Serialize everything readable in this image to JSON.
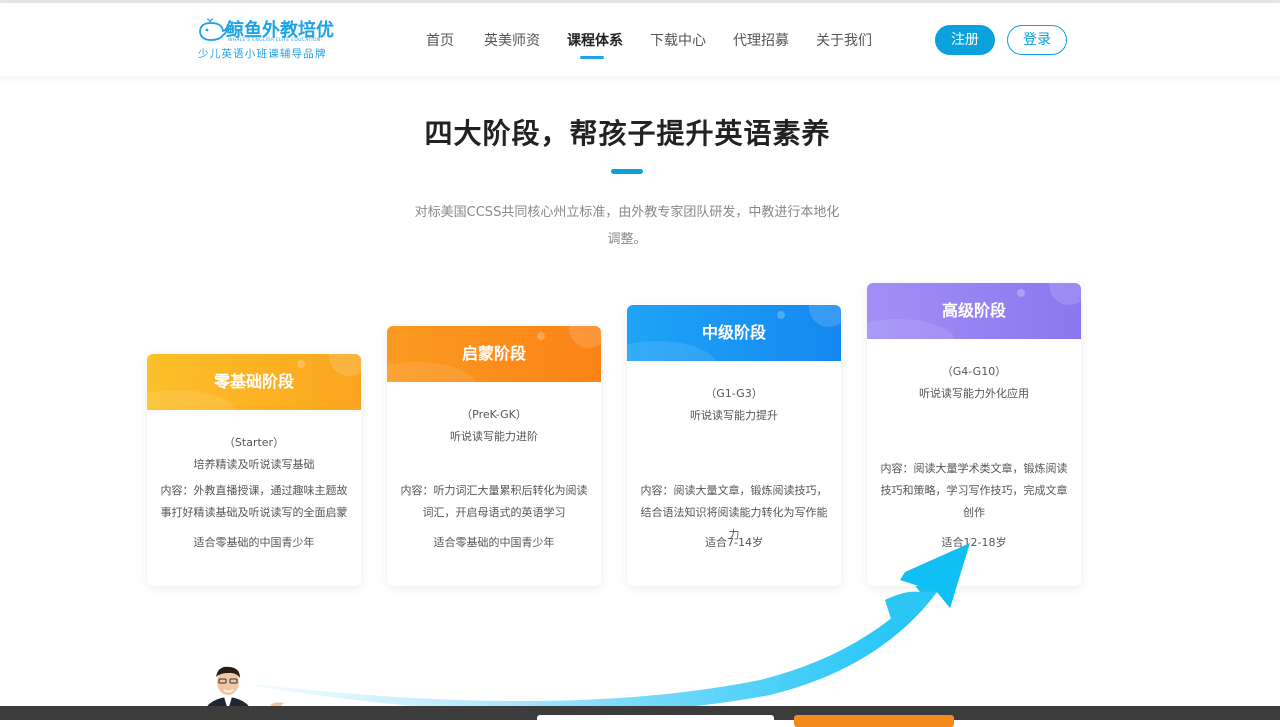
{
  "header": {
    "brand": "鲸鱼外教培优",
    "brand_en": "WHALE'S ENGLISH ELITE EDUCATION",
    "slogan": "少儿英语小班课辅导品牌",
    "nav": [
      {
        "label": "首页",
        "active": false
      },
      {
        "label": "英美师资",
        "active": false
      },
      {
        "label": "课程体系",
        "active": true
      },
      {
        "label": "下载中心",
        "active": false
      },
      {
        "label": "代理招募",
        "active": false
      },
      {
        "label": "关于我们",
        "active": false
      }
    ],
    "register_label": "注册",
    "login_label": "登录"
  },
  "section": {
    "title": "四大阶段，帮孩子提升英语素养",
    "desc": "对标美国CCSS共同核心州立标准，由外教专家团队研发，中教进行本地化调整。"
  },
  "stages": [
    {
      "name": "零基础阶段",
      "level": "（Starter）",
      "goal": "培养精读及听说读写基础",
      "content": "内容：外教直播授课，通过趣味主题故事打好精读基础及听说读写的全面启蒙",
      "suitable": "适合零基础的中国青少年"
    },
    {
      "name": "启蒙阶段",
      "level": "（PreK-GK）",
      "goal": "听说读写能力进阶",
      "content": "内容：听力词汇大量累积后转化为阅读词汇，开启母语式的英语学习",
      "suitable": "适合零基础的中国青少年"
    },
    {
      "name": "中级阶段",
      "level": "（G1-G3）",
      "goal": "听说读写能力提升",
      "content": "内容：阅读大量文章，锻炼阅读技巧，结合语法知识将阅读能力转化为写作能力",
      "suitable": "适合7-14岁"
    },
    {
      "name": "高级阶段",
      "level": "（G4-G10）",
      "goal": "听说读写能力外化应用",
      "content": "内容：阅读大量学术类文章，锻炼阅读技巧和策略，学习写作技巧，完成文章创作",
      "suitable": "适合12-18岁"
    }
  ],
  "colors": {
    "accent": "#0aa1dd",
    "stage1": "#fbb024",
    "stage2": "#fb8c1a",
    "stage3": "#1e9af5",
    "stage4": "#9b86f2",
    "footer": "#3c3c3c",
    "footer_button": "#f28a1c"
  }
}
